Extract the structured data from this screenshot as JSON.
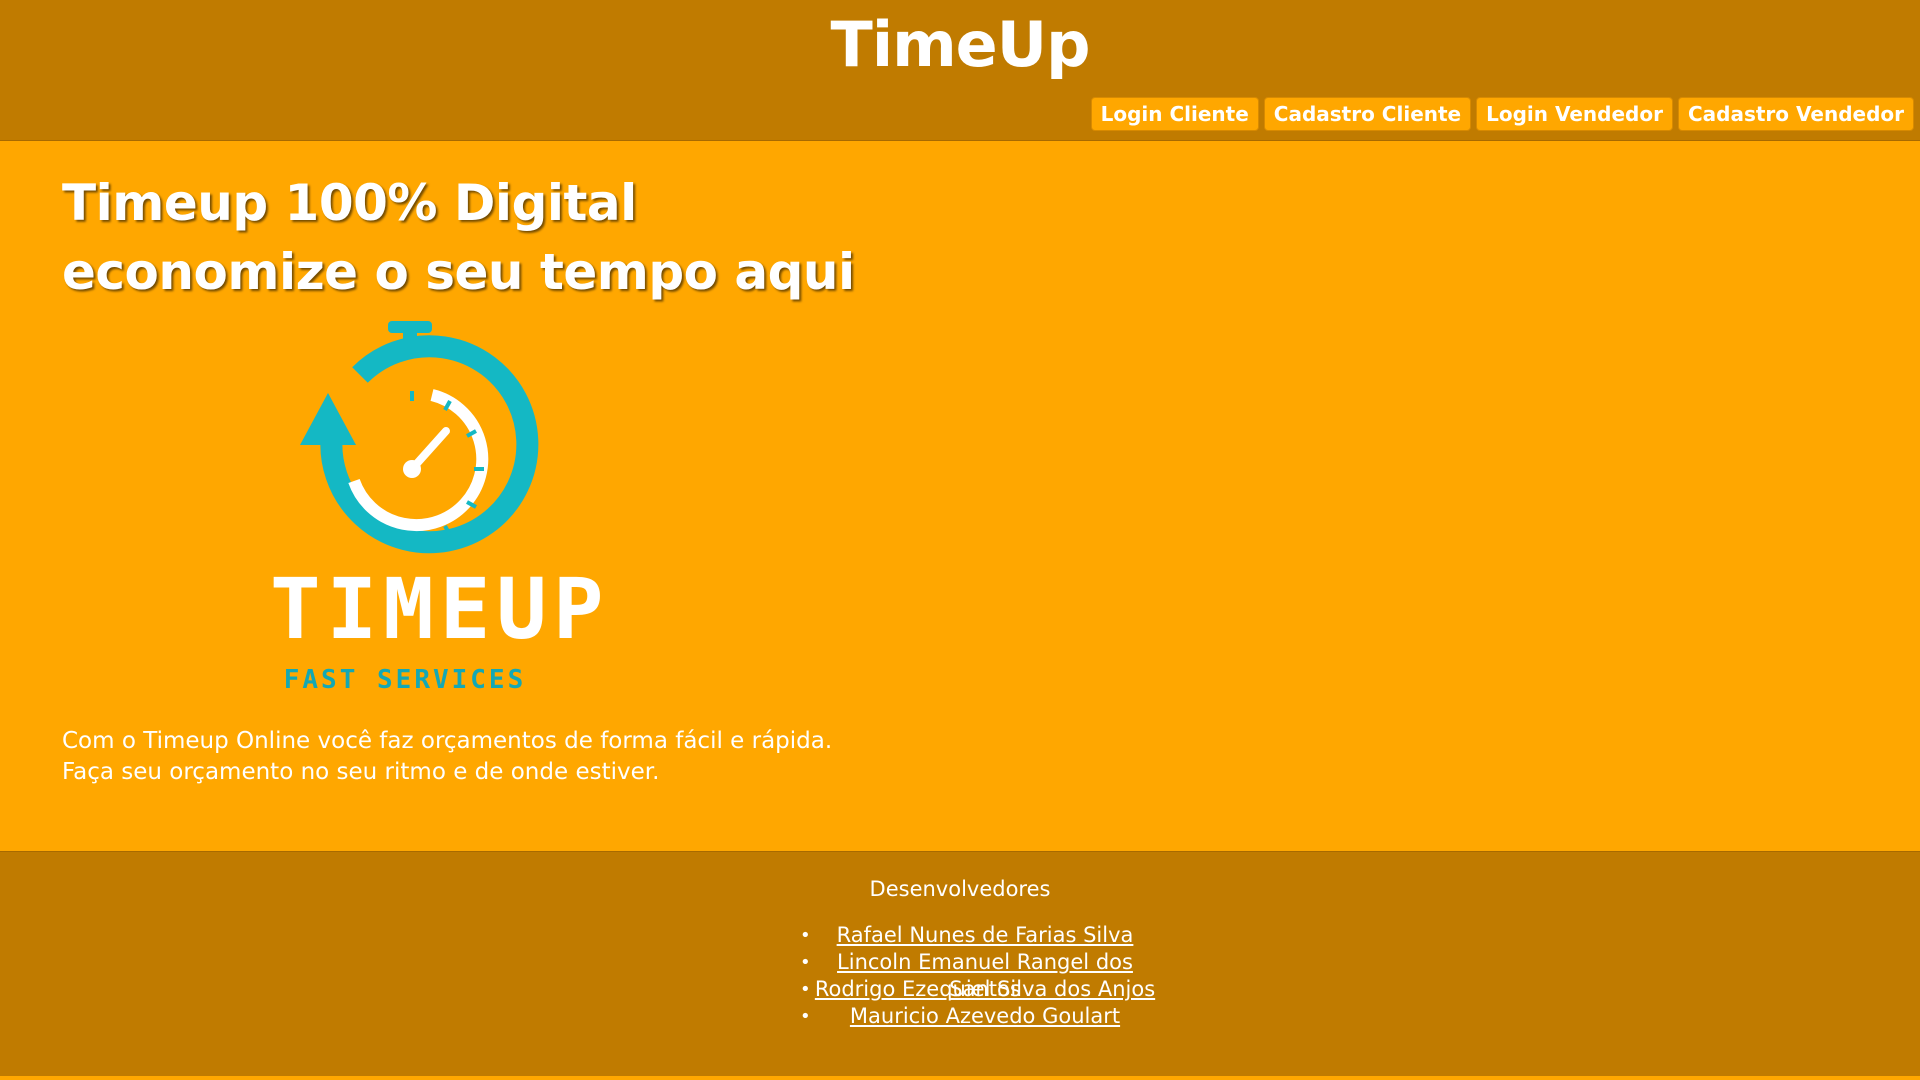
{
  "header": {
    "title": "TimeUp",
    "nav": [
      {
        "label": "Login Cliente",
        "name": "login-cliente-button"
      },
      {
        "label": "Cadastro Cliente",
        "name": "cadastro-cliente-button"
      },
      {
        "label": "Login Vendedor",
        "name": "login-vendedor-button"
      },
      {
        "label": "Cadastro Vendedor",
        "name": "cadastro-vendedor-button"
      }
    ]
  },
  "hero": {
    "headline_line1": "Timeup 100% Digital",
    "headline_line2": "economize o seu tempo aqui",
    "logo": {
      "icon": "stopwatch-refresh-icon",
      "wordmark": "TIMEUP",
      "tagline": "FAST SERVICES",
      "colors": {
        "teal": "#14b8c4",
        "white": "#ffffff"
      }
    },
    "description_line1": "Com o Timeup Online você faz orçamentos de forma fácil e rápida.",
    "description_line2": "Faça seu orçamento no seu ritmo e de onde estiver."
  },
  "footer": {
    "title": "Desenvolvedores",
    "developers": [
      "Rafael Nunes de Farias Silva",
      "Lincoln Emanuel Rangel dos Santos",
      "Rodrigo Ezequiel Silva dos Anjos",
      "Mauricio Azevedo Goulart"
    ]
  },
  "colors": {
    "header_bg": "#c07b00",
    "main_bg": "#ffa700",
    "footer_bg": "#c07b00",
    "text": "#ffffff"
  }
}
